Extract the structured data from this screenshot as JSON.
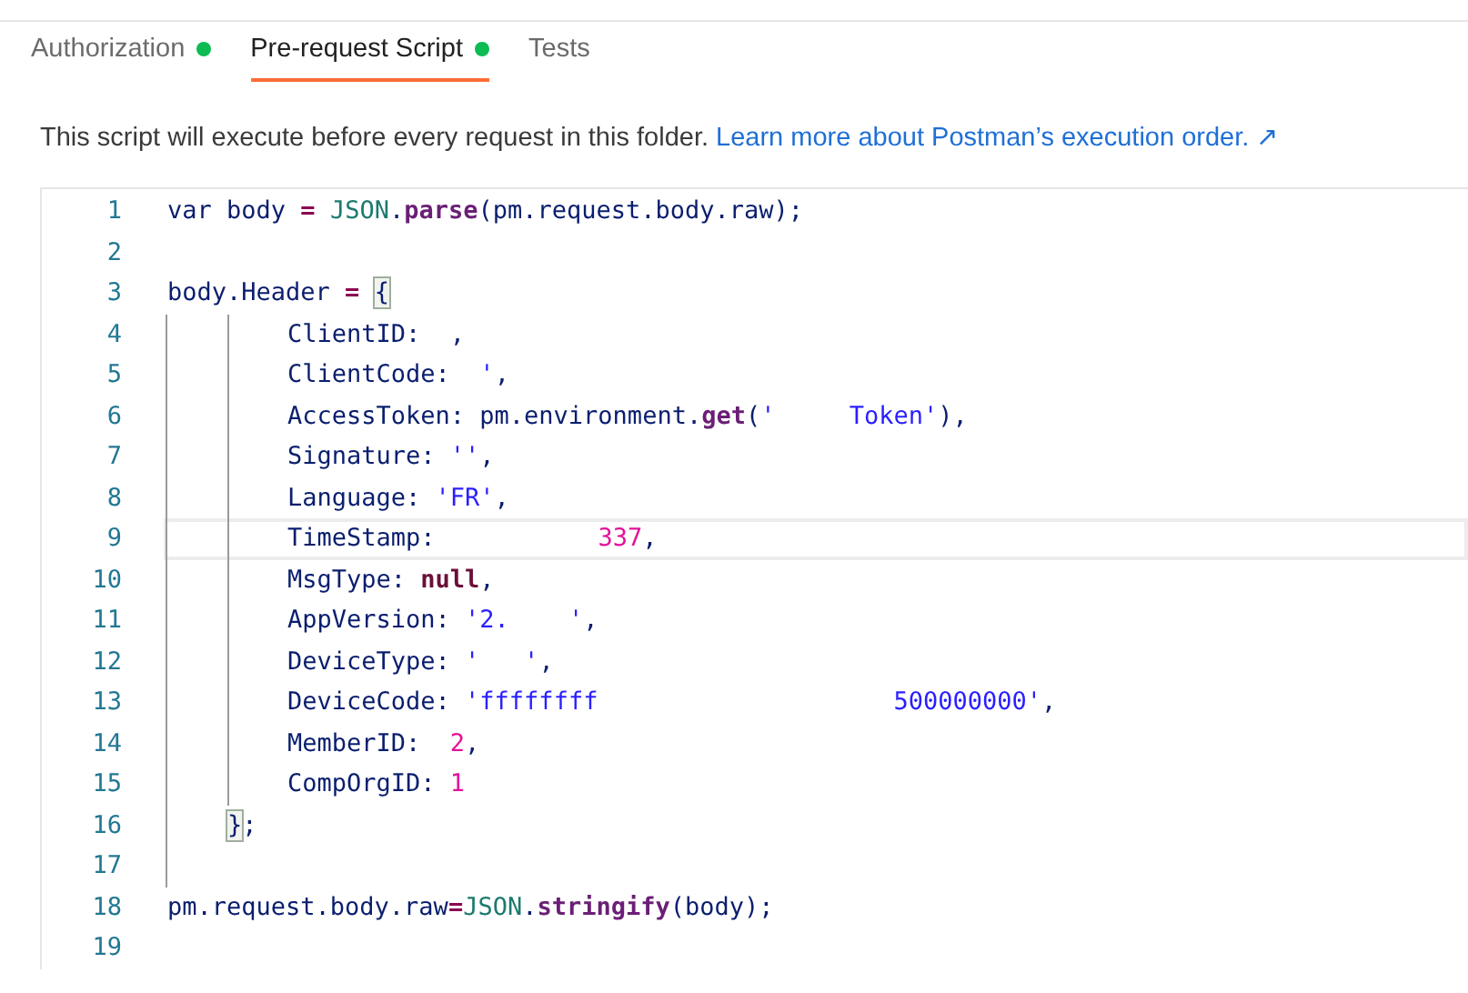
{
  "tabs": [
    {
      "label": "Authorization",
      "selected": false,
      "indicator": true
    },
    {
      "label": "Pre-request Script",
      "selected": true,
      "indicator": true
    },
    {
      "label": "Tests",
      "selected": false,
      "indicator": false
    }
  ],
  "description": {
    "text": "This script will execute before every request in this folder.",
    "link": "Learn more about Postman’s execution order. ↗"
  },
  "editor": {
    "lines": [
      {
        "number": "1",
        "kind": "top",
        "current": false,
        "tokens": [
          {
            "kind": "keyword",
            "t": "var"
          },
          {
            "kind": "plain",
            "t": " body "
          },
          {
            "kind": "op",
            "t": "="
          },
          {
            "kind": "object",
            "t": " JSON"
          },
          {
            "kind": "plain",
            "t": "."
          },
          {
            "kind": "method",
            "t": "parse"
          },
          {
            "kind": "plain",
            "t": "(pm.request.body.raw);"
          }
        ]
      },
      {
        "number": "2",
        "kind": "top",
        "current": false
      },
      {
        "number": "3",
        "kind": "top",
        "current": false,
        "tokens": [
          {
            "kind": "plain",
            "t": "body.Header "
          },
          {
            "kind": "op",
            "t": "= "
          },
          {
            "kind": "bracket",
            "t": "{",
            "match": true
          }
        ]
      },
      {
        "number": "4",
        "kind": "member",
        "current": false,
        "tokens": [
          {
            "kind": "plain",
            "t": "ClientID:  ,"
          }
        ]
      },
      {
        "number": "5",
        "kind": "member",
        "current": false,
        "tokens": [
          {
            "kind": "plain",
            "t": "ClientCode:  "
          },
          {
            "kind": "string",
            "t": "'"
          },
          {
            "kind": "plain",
            "t": ","
          }
        ]
      },
      {
        "number": "6",
        "kind": "member",
        "current": false,
        "tokens": [
          {
            "kind": "plain",
            "t": "AccessToken: pm.environment."
          },
          {
            "kind": "method",
            "t": "get"
          },
          {
            "kind": "plain",
            "t": "("
          },
          {
            "kind": "string",
            "t": "'     Token'"
          },
          {
            "kind": "plain",
            "t": "),"
          }
        ]
      },
      {
        "number": "7",
        "kind": "member",
        "current": false,
        "tokens": [
          {
            "kind": "plain",
            "t": "Signature: "
          },
          {
            "kind": "string",
            "t": "''"
          },
          {
            "kind": "plain",
            "t": ","
          }
        ]
      },
      {
        "number": "8",
        "kind": "member",
        "current": false,
        "tokens": [
          {
            "kind": "plain",
            "t": "Language: "
          },
          {
            "kind": "string",
            "t": "'FR'"
          },
          {
            "kind": "plain",
            "t": ","
          }
        ]
      },
      {
        "number": "9",
        "kind": "member",
        "current": true,
        "tokens": [
          {
            "kind": "plain",
            "t": "TimeStamp:           "
          },
          {
            "kind": "number",
            "t": "337"
          },
          {
            "kind": "plain",
            "t": ","
          }
        ]
      },
      {
        "number": "10",
        "kind": "member",
        "current": false,
        "tokens": [
          {
            "kind": "plain",
            "t": "MsgType: "
          },
          {
            "kind": "literal",
            "t": "null"
          },
          {
            "kind": "plain",
            "t": ","
          }
        ]
      },
      {
        "number": "11",
        "kind": "member",
        "current": false,
        "tokens": [
          {
            "kind": "plain",
            "t": "AppVersion: "
          },
          {
            "kind": "string",
            "t": "'2.    '"
          },
          {
            "kind": "plain",
            "t": ","
          }
        ]
      },
      {
        "number": "12",
        "kind": "member",
        "current": false,
        "tokens": [
          {
            "kind": "plain",
            "t": "DeviceType: "
          },
          {
            "kind": "string",
            "t": "'   '"
          },
          {
            "kind": "plain",
            "t": ","
          }
        ]
      },
      {
        "number": "13",
        "kind": "member",
        "current": false,
        "tokens": [
          {
            "kind": "plain",
            "t": "DeviceCode: "
          },
          {
            "kind": "string",
            "t": "'ffffffff                    500000000'"
          },
          {
            "kind": "plain",
            "t": ","
          }
        ]
      },
      {
        "number": "14",
        "kind": "member",
        "current": false,
        "tokens": [
          {
            "kind": "plain",
            "t": "MemberID:  "
          },
          {
            "kind": "number",
            "t": "2"
          },
          {
            "kind": "plain",
            "t": ","
          }
        ]
      },
      {
        "number": "15",
        "kind": "member",
        "current": false,
        "tokens": [
          {
            "kind": "plain",
            "t": "CompOrgID: "
          },
          {
            "kind": "number",
            "t": "1"
          }
        ]
      },
      {
        "number": "16",
        "kind": "close",
        "current": false,
        "tokens": [
          {
            "kind": "bracket",
            "t": "}",
            "match": true
          },
          {
            "kind": "plain",
            "t": ";"
          }
        ]
      },
      {
        "number": "17",
        "kind": "close",
        "current": false
      },
      {
        "number": "18",
        "kind": "top",
        "current": false,
        "tokens": [
          {
            "kind": "plain",
            "t": "pm.request.body.raw"
          },
          {
            "kind": "op",
            "t": "="
          },
          {
            "kind": "object",
            "t": "JSON"
          },
          {
            "kind": "plain",
            "t": "."
          },
          {
            "kind": "method",
            "t": "stringify"
          },
          {
            "kind": "plain",
            "t": "(body);"
          }
        ]
      },
      {
        "number": "19",
        "kind": "top",
        "current": false
      }
    ]
  }
}
